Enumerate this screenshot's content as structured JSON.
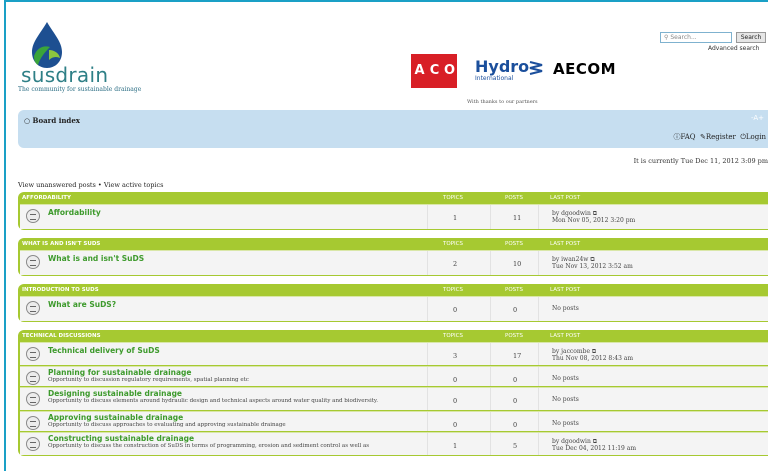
{
  "site": {
    "logo_text": "susdrain",
    "tagline": "The community for sustainable drainage",
    "partners_note": "With thanks to our partners",
    "partners": [
      "ACO",
      "Hydro",
      "International",
      "AECOM"
    ]
  },
  "search": {
    "placeholder": "Search...",
    "button": "Search",
    "advanced": "Advanced search"
  },
  "nav": {
    "board_index": "Board index",
    "controls": "-A+",
    "faq": "FAQ",
    "register": "Register",
    "login": "Login"
  },
  "current_time": "It is currently Tue Dec 11, 2012 3:09 pm",
  "view_links": "View unanswered posts • View active topics",
  "columns": {
    "topics": "TOPICS",
    "posts": "POSTS",
    "last_post": "LAST POST"
  },
  "forums": [
    {
      "category": "AFFORDABILITY",
      "rows": [
        {
          "title": "Affordability",
          "desc": "",
          "topics": "1",
          "posts": "11",
          "last_by": "by dgoodwin",
          "last_date": "Mon Nov 05, 2012 3:20 pm"
        }
      ]
    },
    {
      "category": "WHAT IS AND ISN'T SUDS",
      "rows": [
        {
          "title": "What is and isn't SuDS",
          "desc": "",
          "topics": "2",
          "posts": "10",
          "last_by": "by iwan24w",
          "last_date": "Tue Nov 13, 2012 3:52 am"
        }
      ]
    },
    {
      "category": "INTRODUCTION TO SUDS",
      "rows": [
        {
          "title": "What are SuDS?",
          "desc": "",
          "topics": "0",
          "posts": "0",
          "last_by": "No posts",
          "last_date": ""
        }
      ]
    },
    {
      "category": "TECHNICAL DISCUSSIONS",
      "rows": [
        {
          "title": "Technical delivery of SuDS",
          "desc": "",
          "topics": "3",
          "posts": "17",
          "last_by": "by jaccombe",
          "last_date": "Thu Nov 08, 2012 8:43 am"
        },
        {
          "title": "Planning for sustainable drainage",
          "desc": "Opportunity to discussion regulatory requirements, spatial planning etc",
          "topics": "0",
          "posts": "0",
          "last_by": "No posts",
          "last_date": ""
        },
        {
          "title": "Designing sustainable drainage",
          "desc": "Opportunity to discuss elements around hydraulic design and technical aspects around water quality and biodiversity.",
          "topics": "0",
          "posts": "0",
          "last_by": "No posts",
          "last_date": ""
        },
        {
          "title": "Approving sustainable drainage",
          "desc": "Opportunity to discuss approaches to evaluating and approving sustainable drainage",
          "topics": "0",
          "posts": "0",
          "last_by": "No posts",
          "last_date": ""
        },
        {
          "title": "Constructing sustainable drainage",
          "desc": "Opportunity to discuss the construction of SuDS in terms of programming, erosion and sediment control as well as",
          "topics": "1",
          "posts": "5",
          "last_by": "by dgoodwin",
          "last_date": "Tue Dec 04, 2012 11:19 am"
        }
      ]
    }
  ]
}
